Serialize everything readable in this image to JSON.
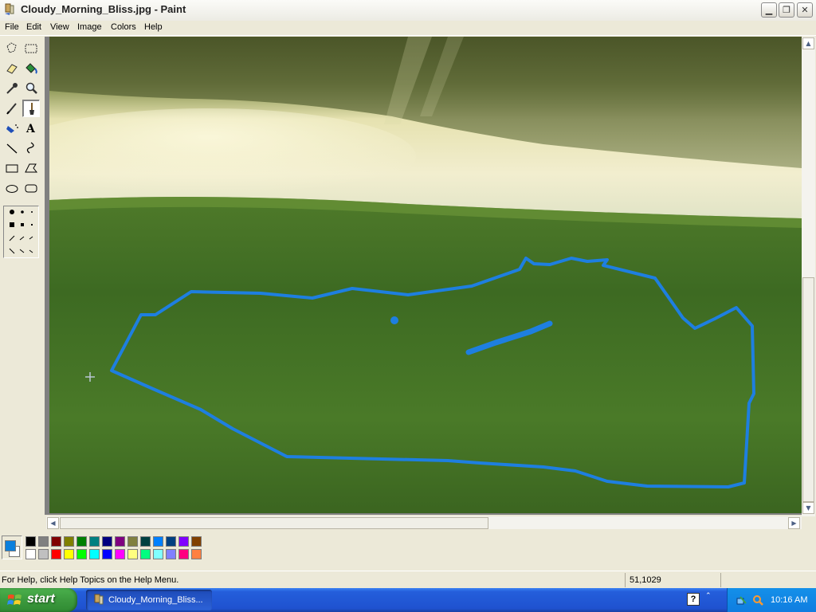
{
  "window": {
    "title": "Cloudy_Morning_Bliss.jpg - Paint",
    "controls": [
      "minimize",
      "maximize",
      "close"
    ]
  },
  "menu": [
    "File",
    "Edit",
    "View",
    "Image",
    "Colors",
    "Help"
  ],
  "toolbox": {
    "tools": [
      "free-form-select",
      "rectangle-select",
      "eraser",
      "fill-with-color",
      "pick-color",
      "magnifier",
      "pencil",
      "brush",
      "airbrush",
      "text",
      "line",
      "curve",
      "rectangle",
      "polygon",
      "ellipse",
      "rounded-rectangle"
    ],
    "selected_tool": "brush"
  },
  "colors": {
    "foreground": "#0A7FDD",
    "background": "#FFFFFF",
    "stroke": "#1E7FE0",
    "palette_top": [
      "#000000",
      "#808080",
      "#800000",
      "#808000",
      "#008000",
      "#008080",
      "#000080",
      "#800080",
      "#808040",
      "#004040",
      "#0080FF",
      "#004080",
      "#8000FF",
      "#804000"
    ],
    "palette_bottom": [
      "#FFFFFF",
      "#C0C0C0",
      "#FF0000",
      "#FFFF00",
      "#00FF00",
      "#00FFFF",
      "#0000FF",
      "#FF00FF",
      "#FFFF80",
      "#00FF80",
      "#80FFFF",
      "#8080FF",
      "#FF0080",
      "#FF8040"
    ]
  },
  "status": {
    "help_text": "For Help, click Help Topics on the Help Menu.",
    "coordinates": "51,1029"
  },
  "taskbar": {
    "start_label": "start",
    "task_label": "Cloudy_Morning_Bliss...",
    "clock": "10:16 AM"
  }
}
